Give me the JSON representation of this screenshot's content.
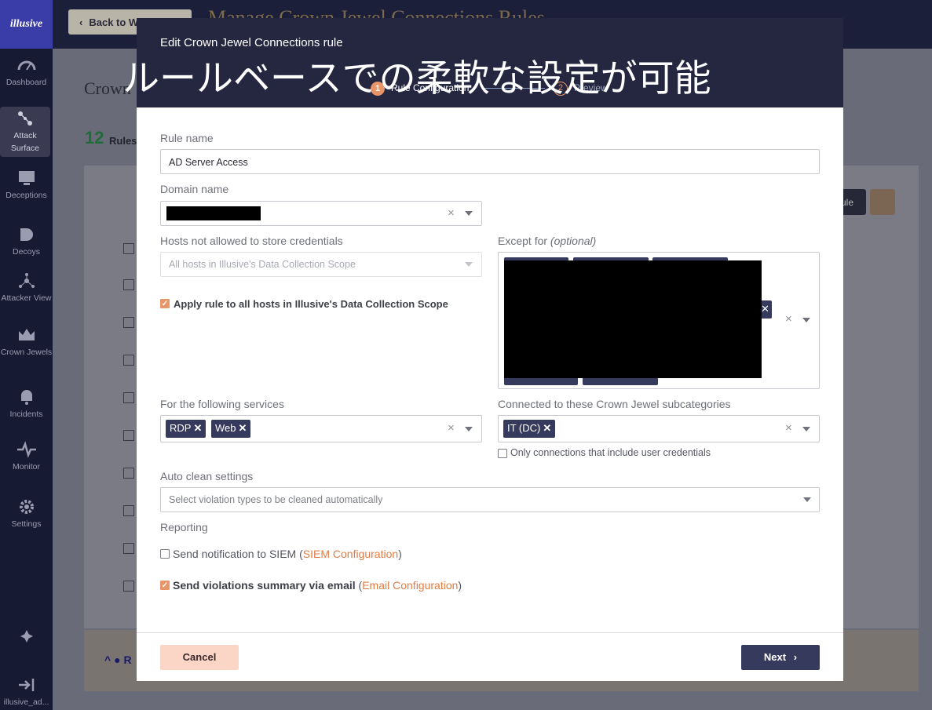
{
  "app": {
    "logo": "illusive"
  },
  "sidebar": {
    "items": [
      {
        "label": "Dashboard"
      },
      {
        "label": "Attack Surface"
      },
      {
        "label": "Deceptions"
      },
      {
        "label": "Decoys"
      },
      {
        "label": "Attacker View"
      },
      {
        "label": "Crown Jewels"
      },
      {
        "label": "Incidents"
      },
      {
        "label": "Monitor"
      },
      {
        "label": "Settings"
      }
    ],
    "user": "illusive_ad..."
  },
  "background": {
    "back_label": "Back to Web...",
    "page_title": "Manage Crown Jewel Connections Rules",
    "heading": "Crown",
    "count": "12",
    "count_label": "Rules",
    "rule_button": "ule",
    "bottom_label": "R"
  },
  "modal": {
    "title": "Edit Crown Jewel Connections rule",
    "overlay_caption": "ルールベースでの柔軟な設定が可能",
    "steps": [
      {
        "number": "1",
        "label": "Rule Configuration"
      },
      {
        "number": "2",
        "label": "Preview"
      }
    ],
    "rule_name": {
      "label": "Rule name",
      "value": "AD Server Access"
    },
    "domain_name": {
      "label": "Domain name"
    },
    "hosts_not_allowed": {
      "label": "Hosts not allowed to store credentials",
      "placeholder": "All hosts in Illusive's Data Collection Scope"
    },
    "apply_all": {
      "label": "Apply rule to all hosts in Illusive's Data Collection Scope",
      "checked": true
    },
    "except_for": {
      "label": "Except for",
      "optional": "(optional)"
    },
    "services": {
      "label": "For the following services",
      "tags": [
        "RDP",
        "Web"
      ]
    },
    "subcategories": {
      "label": "Connected to these Crown Jewel subcategories",
      "tags": [
        "IT (DC)"
      ]
    },
    "only_credentials": {
      "label": "Only connections that include user credentials",
      "checked": false
    },
    "auto_clean": {
      "label": "Auto clean settings",
      "placeholder": "Select violation types to be cleaned automatically"
    },
    "reporting": {
      "label": "Reporting",
      "siem": {
        "text": "Send notification to SIEM",
        "link": "SIEM Configuration",
        "checked": false
      },
      "email": {
        "text": "Send violations summary via email",
        "link": "Email Configuration",
        "checked": true
      }
    },
    "cancel_label": "Cancel",
    "next_label": "Next"
  },
  "colors": {
    "accent": "#e8956a",
    "navy": "#252741",
    "tag": "#363a5c"
  }
}
